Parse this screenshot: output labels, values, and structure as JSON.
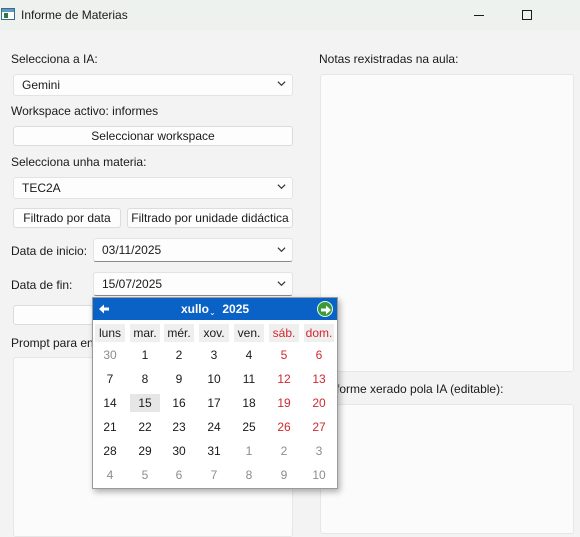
{
  "window": {
    "title": "Informe de Materias"
  },
  "left": {
    "ai_label": "Selecciona a IA:",
    "ai_value": "Gemini",
    "workspace_label": "Workspace activo: informes",
    "workspace_button": "Seleccionar workspace",
    "subject_label": "Selecciona unha materia:",
    "subject_value": "TEC2A",
    "filter_date_button": "Filtrado por data",
    "filter_unit_button": "Filtrado por unidade didáctica",
    "start_label": "Data de inicio:",
    "start_value": "03/11/2025",
    "end_label": "Data de fin:",
    "end_value": "15/07/2025",
    "prompt_label": "Prompt para en"
  },
  "right": {
    "notes_label": "Notas rexistradas na aula:",
    "report_label": "forme xerado pola IA (editable):"
  },
  "calendar": {
    "month": "xullo",
    "year": "2025",
    "weekdays": [
      "luns",
      "mar.",
      "mér.",
      "xov.",
      "ven.",
      "sáb.",
      "dom."
    ],
    "weeks": [
      [
        "30",
        "1",
        "2",
        "3",
        "4",
        "5",
        "6"
      ],
      [
        "7",
        "8",
        "9",
        "10",
        "11",
        "12",
        "13"
      ],
      [
        "14",
        "15",
        "16",
        "17",
        "18",
        "19",
        "20"
      ],
      [
        "21",
        "22",
        "23",
        "24",
        "25",
        "26",
        "27"
      ],
      [
        "28",
        "29",
        "30",
        "31",
        "1",
        "2",
        "3"
      ],
      [
        "4",
        "5",
        "6",
        "7",
        "8",
        "9",
        "10"
      ]
    ],
    "selected_day": "15",
    "header_color": "#0b62c6",
    "weekend_color": "#d0282f"
  },
  "icons": {
    "app": "window-app-icon",
    "minimize": "minimize-icon",
    "maximize": "maximize-icon",
    "dropdown": "chevron-down-icon",
    "prev": "arrow-left-icon",
    "next": "arrow-right-icon"
  }
}
